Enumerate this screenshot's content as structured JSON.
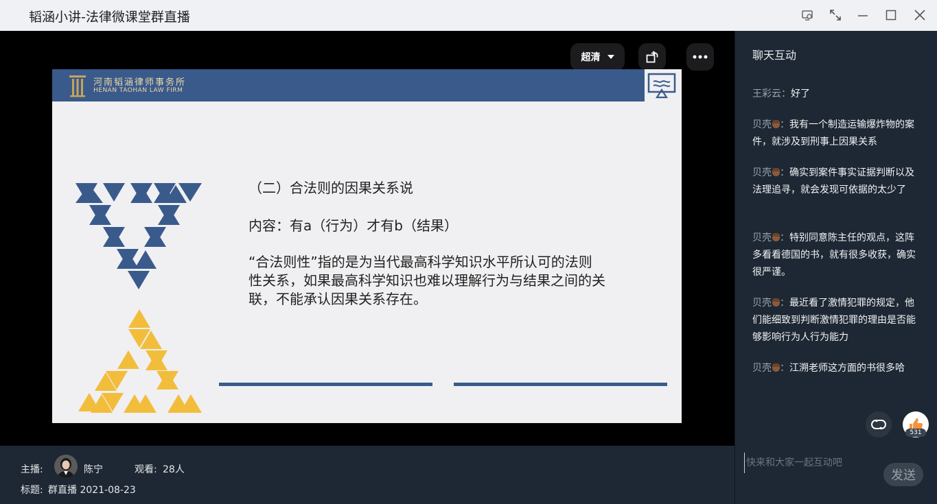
{
  "window": {
    "title": "韬涵小讲-法律微课堂群直播",
    "icons": [
      "screenshot-icon",
      "fullscreen-icon",
      "minimize-icon",
      "maximize-icon",
      "close-icon"
    ]
  },
  "player": {
    "quality_label": "超清",
    "icons": [
      "rotate-icon",
      "more-icon"
    ]
  },
  "slide": {
    "firm_name_cn": "河南韬涵律师事务所",
    "firm_name_en": "HENAN TAOHAN LAW FIRM",
    "title": "（二）合法则的因果关系说",
    "content": "内容：有a（行为）才有b（结果）",
    "paragraph": "“合法则性”指的是为当代最高科学知识水平所认可的法则性关系，如果最高科学知识也难以理解行为与结果之间的关联，不能承认因果关系存在。",
    "colors": {
      "header": "#3a5a8c",
      "blue_triangle": "#3a5a8c",
      "yellow_triangle": "#f3bd3c"
    }
  },
  "info": {
    "host_label": "主播:",
    "host_name": "陈宁",
    "viewers_label": "观看:",
    "viewers_count": "28人",
    "topic_label": "标题:",
    "topic": "群直播 2021-08-23"
  },
  "chat": {
    "title": "聊天互动",
    "messages": [
      {
        "name": "王彩云",
        "badge": false,
        "sep": "：",
        "text": "好了"
      },
      {
        "name": "贝壳",
        "badge": true,
        "sep": "：",
        "text": "我有一个制造运输爆炸物的案件，就涉及到刑事上因果关系"
      },
      {
        "name": "贝壳",
        "badge": true,
        "sep": "：",
        "text": "确实到案件事实证据判断以及法理追寻，就会发现可依据的太少了"
      },
      {
        "name": "贝壳",
        "badge": true,
        "sep": "：",
        "text": "特别同意陈主任的观点，这阵多看看德国的书，就有很多收获，确实很严谨。"
      },
      {
        "name": "贝壳",
        "badge": true,
        "sep": "：",
        "text": "最近看了激情犯罪的规定，他们能细致到判断激情犯罪的理由是否能够影响行为人行为能力"
      },
      {
        "name": "贝壳",
        "badge": true,
        "sep": "：",
        "text": "江溯老师这方面的书很多哈"
      }
    ],
    "like_count": "531",
    "input_placeholder": "快来和大家一起互动吧",
    "send_label": "发送"
  }
}
